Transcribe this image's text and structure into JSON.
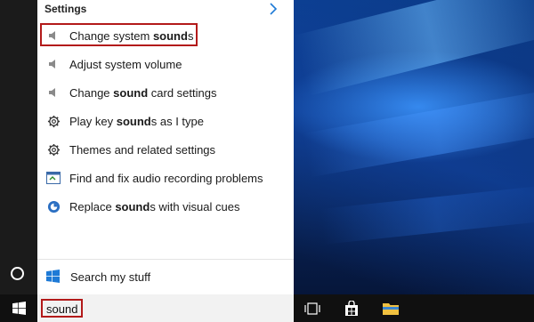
{
  "panel": {
    "section_header": "Settings",
    "results": [
      {
        "pre": "Change system ",
        "bold": "sound",
        "post": "s",
        "icon": "speaker-icon"
      },
      {
        "pre": "Adjust system volume",
        "bold": "",
        "post": "",
        "icon": "speaker-icon"
      },
      {
        "pre": "Change ",
        "bold": "sound",
        "post": " card settings",
        "icon": "speaker-icon"
      },
      {
        "pre": "Play key ",
        "bold": "sound",
        "post": "s as I type",
        "icon": "gear-icon"
      },
      {
        "pre": "Themes and related settings",
        "bold": "",
        "post": "",
        "icon": "gear-icon"
      },
      {
        "pre": "Find and fix audio recording problems",
        "bold": "",
        "post": "",
        "icon": "troubleshoot-icon"
      },
      {
        "pre": "Replace ",
        "bold": "sound",
        "post": "s with visual cues",
        "icon": "ease-of-access-icon"
      }
    ],
    "search_my_stuff": "Search my stuff"
  },
  "taskbar": {
    "search_value": "sound"
  },
  "colors": {
    "highlight": "#b31a1a",
    "windows_blue": "#1e7ad6",
    "taskbar": "#101010"
  }
}
